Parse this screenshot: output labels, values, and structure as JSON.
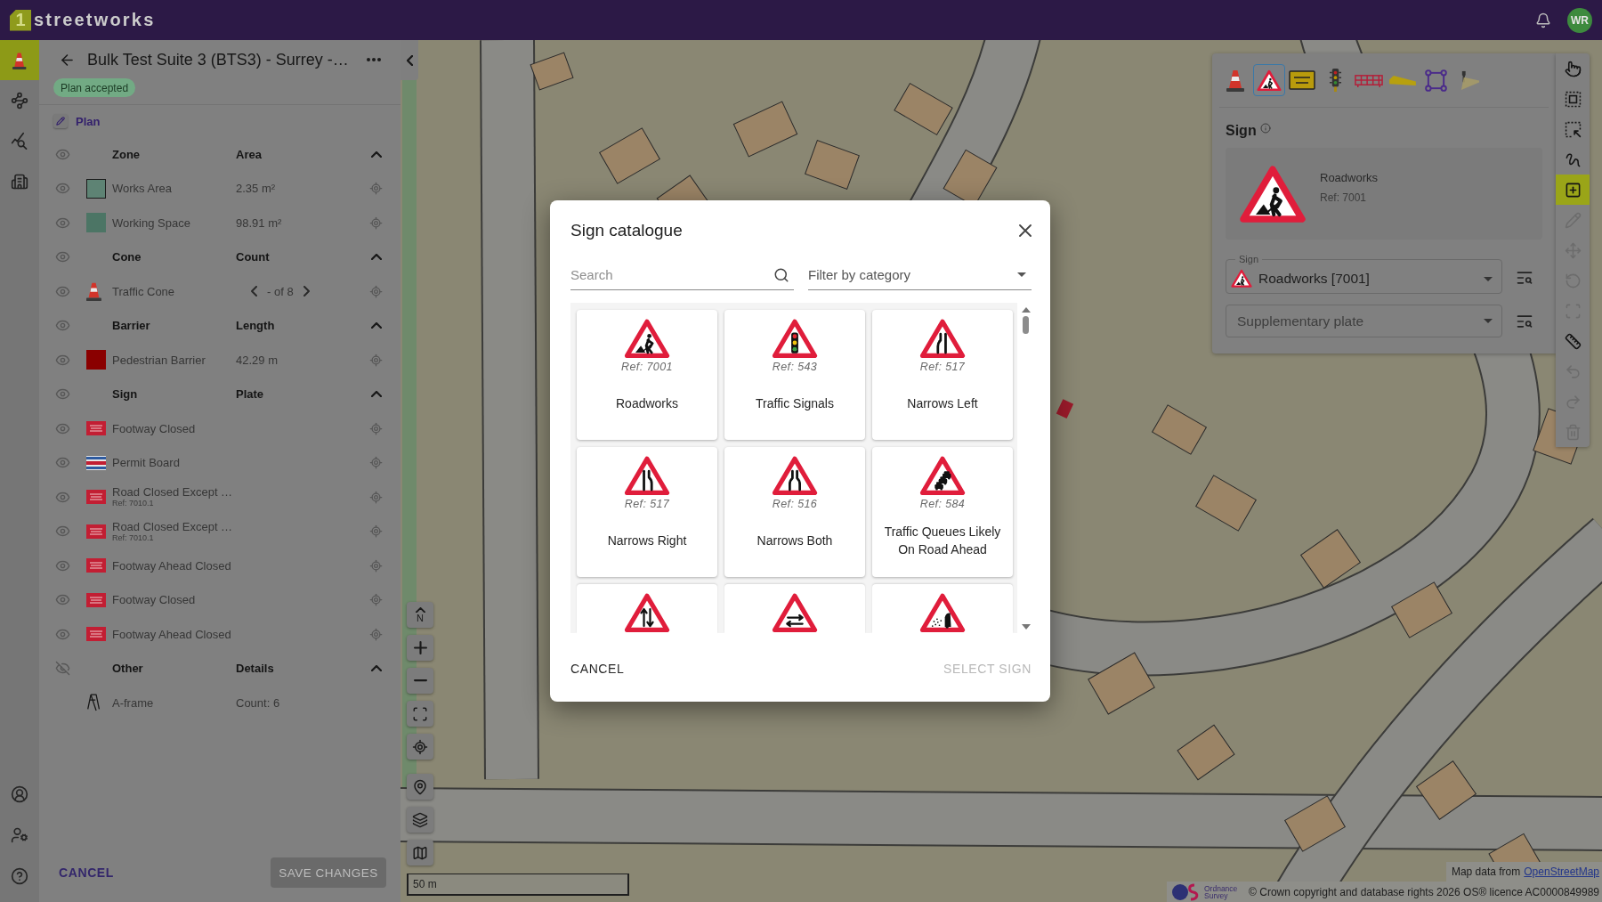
{
  "topbar": {
    "logo_mark": "1",
    "logo_text": "streetworks",
    "avatar": "WR"
  },
  "rail": {
    "top": [
      {
        "kind": "cone",
        "selected": true
      },
      {
        "kind": "network",
        "selected": false
      },
      {
        "kind": "analytics",
        "selected": false
      },
      {
        "kind": "building",
        "selected": false
      }
    ],
    "bottom": [
      {
        "kind": "account"
      },
      {
        "kind": "usersettings"
      },
      {
        "kind": "help"
      }
    ]
  },
  "plan_panel": {
    "title": "Bulk Test Suite 3 (BTS3) - Surrey -…",
    "status": "Plan accepted",
    "section": "Plan",
    "groups": [
      {
        "label": "Zone",
        "column": "Area",
        "visible": true,
        "expanded": true,
        "items": [
          {
            "kind": "swatch",
            "color": "#5e8374",
            "outlined": true,
            "controls": true,
            "name": "Works Area",
            "value": "2.35 m²"
          },
          {
            "kind": "swatch",
            "color": "#4c7565",
            "outlined": false,
            "controls": true,
            "name": "Working Space",
            "value": "98.91 m²"
          }
        ]
      },
      {
        "label": "Cone",
        "column": "Count",
        "visible": true,
        "expanded": true,
        "items": [
          {
            "kind": "cone",
            "controls": true,
            "pager": true,
            "name": "Traffic Cone",
            "value": "- of 8"
          }
        ]
      },
      {
        "label": "Barrier",
        "column": "Length",
        "visible": true,
        "expanded": true,
        "items": [
          {
            "kind": "swatch",
            "color": "#8a0000",
            "outlined": false,
            "controls": true,
            "name": "Pedestrian Barrier",
            "value": "42.29 m"
          }
        ]
      },
      {
        "label": "Sign",
        "column": "Plate",
        "visible": true,
        "expanded": true,
        "items": [
          {
            "kind": "plate",
            "controls": true,
            "name": "Footway Closed"
          },
          {
            "kind": "permit",
            "controls": true,
            "name": "Permit Board"
          },
          {
            "kind": "plate",
            "controls": true,
            "name": "Road Closed Except …",
            "ref": "Ref: 7010.1"
          },
          {
            "kind": "plate",
            "controls": true,
            "name": "Road Closed Except …",
            "ref": "Ref: 7010.1"
          },
          {
            "kind": "plate",
            "controls": true,
            "name": "Footway Ahead Closed"
          },
          {
            "kind": "plate",
            "controls": true,
            "name": "Footway Closed"
          },
          {
            "kind": "plate",
            "controls": true,
            "name": "Footway Ahead Closed"
          }
        ]
      },
      {
        "label": "Other",
        "column": "Details",
        "visible": false,
        "expanded": true,
        "items": [
          {
            "kind": "aframe",
            "name": "A-frame",
            "value": "Count: 6"
          }
        ]
      }
    ],
    "cancel": "CANCEL",
    "save": {
      "label": "SAVE CHANGES",
      "disabled": true
    }
  },
  "map": {
    "controls": [
      {
        "kind": "north",
        "label": "N"
      },
      {
        "kind": "zoomin"
      },
      {
        "kind": "zoomout"
      },
      {
        "kind": "fit"
      },
      {
        "kind": "locate"
      },
      {
        "kind": "pin"
      },
      {
        "kind": "layers"
      },
      {
        "kind": "basemap"
      }
    ],
    "scale": "50 m",
    "attribution": {
      "text": "Map data from",
      "link": "OpenStreetMap",
      "os_logo": [
        "Ordnance",
        "Survey"
      ],
      "copyright": "© Crown copyright and database rights 2026 OS® licence AC0000849989"
    }
  },
  "sign_panel": {
    "tools": [
      {
        "kind": "cone",
        "selected": false
      },
      {
        "kind": "sign",
        "selected": true
      },
      {
        "kind": "board",
        "selected": false
      },
      {
        "kind": "lights",
        "selected": false
      },
      {
        "kind": "barrier",
        "selected": false
      },
      {
        "kind": "wedge",
        "selected": false
      },
      {
        "kind": "polygon",
        "selected": false
      },
      {
        "kind": "lamp",
        "selected": false
      }
    ],
    "title": "Sign",
    "preview": {
      "kind": "roadworks",
      "name": "Roadworks",
      "ref": "Ref: 7001"
    },
    "sign_field": {
      "label": "Sign",
      "kind": "roadworks",
      "value": "Roadworks [7001]"
    },
    "plate_field": {
      "placeholder": "Supplementary plate"
    }
  },
  "edit_tools": [
    {
      "kind": "pointer",
      "selected": false,
      "disabled": false
    },
    {
      "kind": "boxselect",
      "selected": false,
      "disabled": false
    },
    {
      "kind": "areaselect",
      "selected": false,
      "disabled": false
    },
    {
      "kind": "freehand",
      "selected": false,
      "disabled": false
    },
    {
      "kind": "add",
      "selected": true,
      "disabled": false
    },
    {
      "kind": "edit",
      "selected": false,
      "disabled": true
    },
    {
      "kind": "move",
      "selected": false,
      "disabled": true
    },
    {
      "kind": "rotate",
      "selected": false,
      "disabled": true
    },
    {
      "kind": "resize",
      "selected": false,
      "disabled": true
    },
    {
      "kind": "measure",
      "selected": false,
      "disabled": false
    },
    {
      "kind": "undo",
      "selected": false,
      "disabled": true
    },
    {
      "kind": "redo",
      "selected": false,
      "disabled": true
    },
    {
      "kind": "delete",
      "selected": false,
      "disabled": true
    }
  ],
  "sign_catalogue": {
    "title": "Sign catalogue",
    "search": {
      "placeholder": "Search"
    },
    "filter": {
      "placeholder": "Filter by category"
    },
    "signs": [
      {
        "kind": "roadworks",
        "ref": "Ref: 7001",
        "name": "Roadworks",
        "selected": false
      },
      {
        "kind": "lights",
        "ref": "Ref: 543",
        "name": "Traffic Signals",
        "selected": false
      },
      {
        "kind": "narrowleft",
        "ref": "Ref: 517",
        "name": "Narrows Left",
        "selected": false
      },
      {
        "kind": "narrowright",
        "ref": "Ref: 517",
        "name": "Narrows Right",
        "selected": false
      },
      {
        "kind": "narrowboth",
        "ref": "Ref: 516",
        "name": "Narrows Both",
        "selected": false
      },
      {
        "kind": "queue",
        "ref": "Ref: 584",
        "name": "Traffic Queues Likely On Road Ahead",
        "selected": false
      },
      {
        "kind": "twoway",
        "selected": false
      },
      {
        "kind": "crossflow",
        "selected": false
      },
      {
        "kind": "chippings",
        "selected": false
      }
    ],
    "cancel": "CANCEL",
    "select": {
      "label": "SELECT SIGN",
      "disabled": true
    }
  }
}
